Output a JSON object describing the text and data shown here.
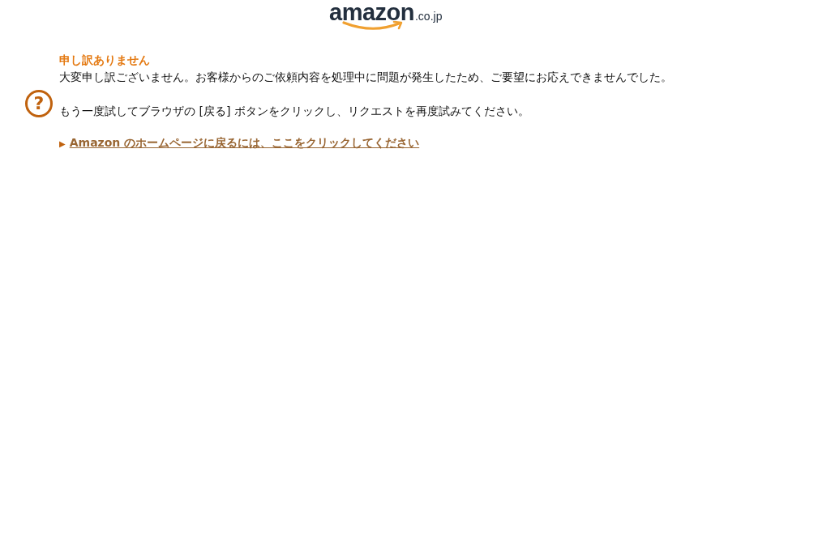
{
  "logo": {
    "wordmark": "amazon",
    "domain": ".co.jp"
  },
  "error": {
    "heading": "申し訳ありません",
    "message": "大変申し訳ございません。お客様からのご依頼内容を処理中に問題が発生したため、ご要望にお応えできませんでした。",
    "help_icon": "?",
    "instruction": "もう一度試してブラウザの [戻る] ボタンをクリックし、リクエストを再度試みてください。",
    "link_marker": "▶",
    "link": "Amazon のホームページに戻るには、ここをクリックしてください"
  }
}
